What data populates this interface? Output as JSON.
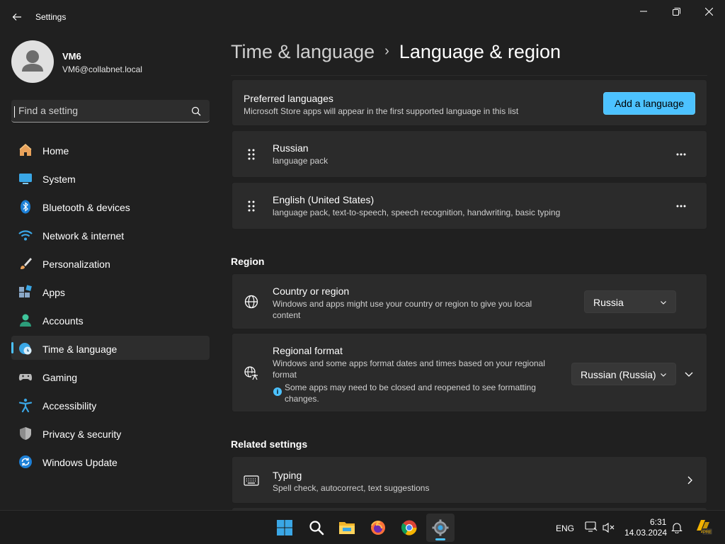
{
  "window": {
    "title": "Settings",
    "controls": [
      "minimize-icon",
      "maximize-icon",
      "close-icon"
    ]
  },
  "profile": {
    "name": "VM6",
    "email": "VM6@collabnet.local"
  },
  "search": {
    "placeholder": "Find a setting",
    "value": ""
  },
  "sidebar": {
    "items": [
      {
        "label": "Home",
        "icon": "home-icon",
        "active": false
      },
      {
        "label": "System",
        "icon": "system-icon",
        "active": false
      },
      {
        "label": "Bluetooth & devices",
        "icon": "bluetooth-icon",
        "active": false
      },
      {
        "label": "Network & internet",
        "icon": "wifi-icon",
        "active": false
      },
      {
        "label": "Personalization",
        "icon": "brush-icon",
        "active": false
      },
      {
        "label": "Apps",
        "icon": "apps-icon",
        "active": false
      },
      {
        "label": "Accounts",
        "icon": "accounts-icon",
        "active": false
      },
      {
        "label": "Time & language",
        "icon": "globe-clock-icon",
        "active": true
      },
      {
        "label": "Gaming",
        "icon": "gamepad-icon",
        "active": false
      },
      {
        "label": "Accessibility",
        "icon": "accessibility-icon",
        "active": false
      },
      {
        "label": "Privacy & security",
        "icon": "shield-icon",
        "active": false
      },
      {
        "label": "Windows Update",
        "icon": "update-icon",
        "active": false
      }
    ]
  },
  "breadcrumb": {
    "parent": "Time & language",
    "separator": "›",
    "current": "Language & region"
  },
  "preferred_languages": {
    "title": "Preferred languages",
    "subtitle": "Microsoft Store apps will appear in the first supported language in this list",
    "add_button": "Add a language",
    "languages": [
      {
        "name": "Russian",
        "features": "language pack"
      },
      {
        "name": "English (United States)",
        "features": "language pack, text-to-speech, speech recognition, handwriting, basic typing"
      }
    ]
  },
  "region": {
    "heading": "Region",
    "country": {
      "title": "Country or region",
      "subtitle": "Windows and apps might use your country or region to give you local content",
      "value": "Russia"
    },
    "format": {
      "title": "Regional format",
      "subtitle": "Windows and some apps format dates and times based on your regional format",
      "info": "Some apps may need to be closed and reopened to see formatting changes.",
      "value": "Russian (Russia)"
    }
  },
  "related": {
    "heading": "Related settings",
    "typing": {
      "title": "Typing",
      "subtitle": "Spell check, autocorrect, text suggestions"
    }
  },
  "taskbar": {
    "apps": [
      "start-icon",
      "search-icon",
      "file-explorer-icon",
      "firefox-icon",
      "chrome-icon",
      "settings-icon"
    ],
    "language": "ENG",
    "time": "6:31",
    "date": "14.03.2024"
  },
  "colors": {
    "accent": "#4cc2ff",
    "background": "#202020",
    "card": "#2b2b2b"
  }
}
